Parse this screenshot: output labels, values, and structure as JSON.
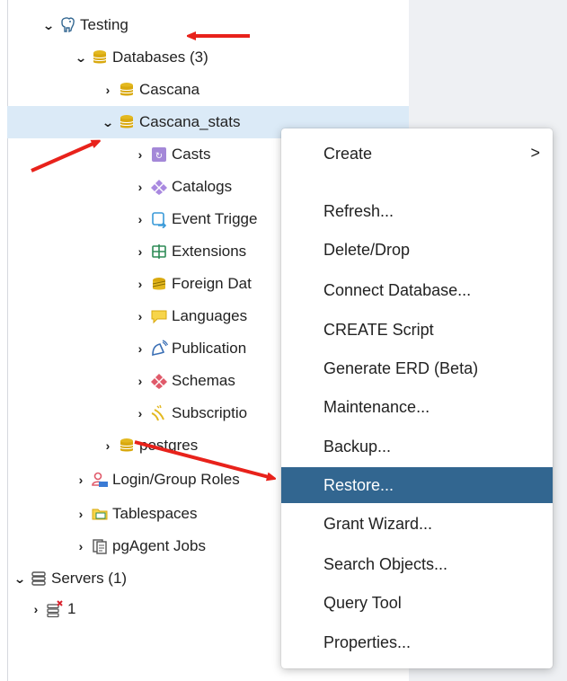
{
  "tree": {
    "server_group": "Testing",
    "databases": "Databases (3)",
    "db_cascana": "Cascana",
    "db_cascana_stats": "Cascana_stats",
    "children": {
      "casts": "Casts",
      "catalogs": "Catalogs",
      "event_triggers": "Event Trigge",
      "extensions": "Extensions",
      "foreign_data": "Foreign Dat",
      "languages": "Languages",
      "publications": "Publication",
      "schemas": "Schemas",
      "subscriptions": "Subscriptio"
    },
    "db_postgres": "postgres",
    "login_roles": "Login/Group Roles",
    "tablespaces": "Tablespaces",
    "pgagent": "pgAgent Jobs",
    "servers": "Servers (1)",
    "server_1": "1"
  },
  "context_menu": {
    "create": "Create",
    "create_chevron": ">",
    "refresh": "Refresh...",
    "delete": "Delete/Drop",
    "connect": "Connect Database...",
    "create_script": "CREATE Script",
    "erd": "Generate ERD (Beta)",
    "maintenance": "Maintenance...",
    "backup": "Backup...",
    "restore": "Restore...",
    "grant": "Grant Wizard...",
    "search": "Search Objects...",
    "query_tool": "Query Tool",
    "properties": "Properties..."
  },
  "colors": {
    "selected_row": "#dbeaf7",
    "menu_active": "#326690",
    "arrow": "#e8221b",
    "database_icon": "#e3b81f"
  }
}
